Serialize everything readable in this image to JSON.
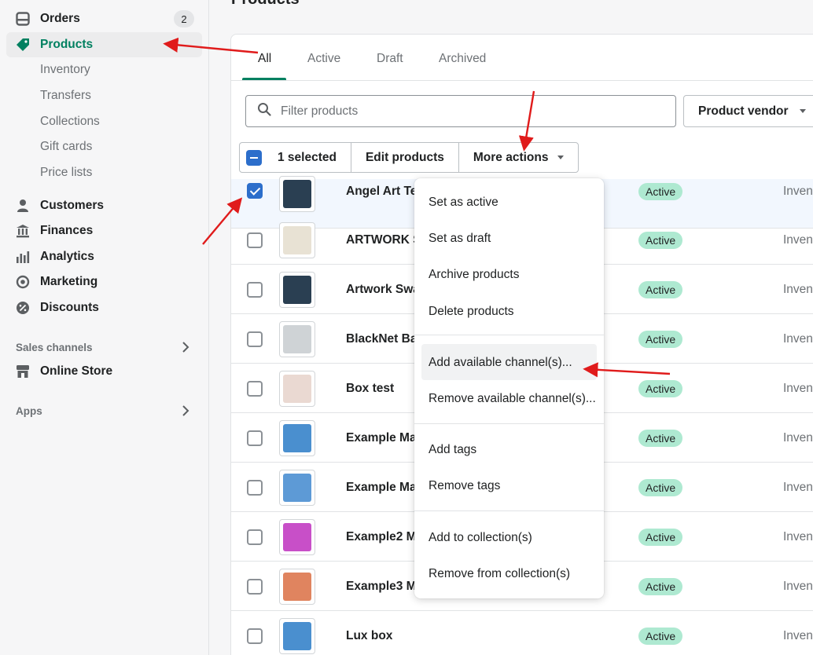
{
  "sidebar": {
    "orders": {
      "label": "Orders",
      "badge": "2"
    },
    "products": {
      "label": "Products"
    },
    "sub_items": [
      "Inventory",
      "Transfers",
      "Collections",
      "Gift cards",
      "Price lists"
    ],
    "customers": "Customers",
    "finances": "Finances",
    "analytics": "Analytics",
    "marketing": "Marketing",
    "discounts": "Discounts",
    "sales_channels_label": "Sales channels",
    "online_store": "Online Store",
    "apps_label": "Apps"
  },
  "page": {
    "title": "Products"
  },
  "tabs": [
    "All",
    "Active",
    "Draft",
    "Archived"
  ],
  "filter": {
    "placeholder": "Filter products",
    "vendor_label": "Product vendor"
  },
  "bulk": {
    "selected": "1 selected",
    "edit": "Edit products",
    "more": "More actions"
  },
  "products": [
    {
      "name": "Angel Art Te",
      "status": "Active",
      "inventory": "Inven",
      "selected": true,
      "thumb_color": "#2a3f52"
    },
    {
      "name": "ARTWORK S",
      "status": "Active",
      "inventory": "Inven",
      "selected": false,
      "thumb_color": "#e8e2d4"
    },
    {
      "name": "Artwork Swa",
      "status": "Active",
      "inventory": "Inven",
      "selected": false,
      "thumb_color": "#2a3f52"
    },
    {
      "name": "BlackNet Ba",
      "status": "Active",
      "inventory": "Inven",
      "selected": false,
      "thumb_color": "#cfd3d6"
    },
    {
      "name": "Box test",
      "status": "Active",
      "inventory": "Inven",
      "selected": false,
      "thumb_color": "#ead9d2"
    },
    {
      "name": "Example Ma",
      "status": "Active",
      "inventory": "Inven",
      "selected": false,
      "thumb_color": "#4a8fcf"
    },
    {
      "name": "Example Ma",
      "status": "Active",
      "inventory": "Inven",
      "selected": false,
      "thumb_color": "#5d9ad6"
    },
    {
      "name": "Example2 M",
      "status": "Active",
      "inventory": "Inven",
      "selected": false,
      "thumb_color": "#c84fc8"
    },
    {
      "name": "Example3 M",
      "status": "Active",
      "inventory": "Inven",
      "selected": false,
      "thumb_color": "#e0845f"
    },
    {
      "name": "Lux box",
      "status": "Active",
      "inventory": "Inven",
      "selected": false,
      "thumb_color": "#4a8fcf"
    }
  ],
  "menu": {
    "set_active": "Set as active",
    "set_draft": "Set as draft",
    "archive": "Archive products",
    "delete": "Delete products",
    "add_channel": "Add available channel(s)...",
    "remove_channel": "Remove available channel(s)...",
    "add_tags": "Add tags",
    "remove_tags": "Remove tags",
    "add_collection": "Add to collection(s)",
    "remove_collection": "Remove from collection(s)"
  },
  "colors": {
    "accent": "#008060",
    "selected_blue": "#2c6ecb",
    "status_green": "#aee9d1",
    "annotation_red": "#e01b1b"
  }
}
